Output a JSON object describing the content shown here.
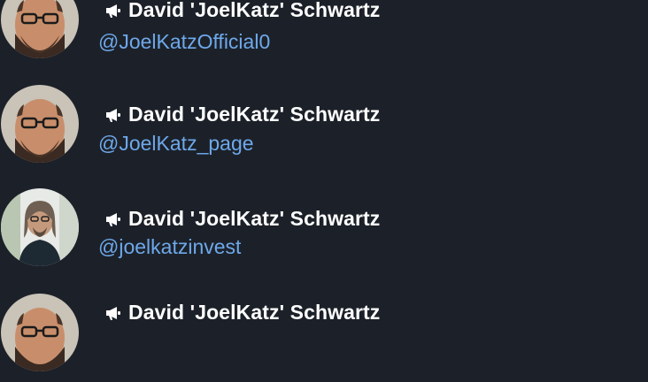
{
  "colors": {
    "background": "#1c2129",
    "name_text": "#ffffff",
    "handle_link": "#6ea8ea"
  },
  "contacts": [
    {
      "name": "David 'JoelKatz' Schwartz",
      "handle": "@JoelKatzOfficial0",
      "icon": "megaphone-icon",
      "avatar": "portrait-bald-beard-glasses"
    },
    {
      "name": "David 'JoelKatz' Schwartz",
      "handle": "@JoelKatz_page",
      "icon": "megaphone-icon",
      "avatar": "portrait-bald-beard-glasses"
    },
    {
      "name": "David 'JoelKatz' Schwartz",
      "handle": "@joelkatzinvest",
      "icon": "megaphone-icon",
      "avatar": "portrait-long-hair-outdoor"
    },
    {
      "name": "David 'JoelKatz' Schwartz",
      "handle": "",
      "icon": "megaphone-icon",
      "avatar": "portrait-bald-beard-glasses"
    }
  ]
}
